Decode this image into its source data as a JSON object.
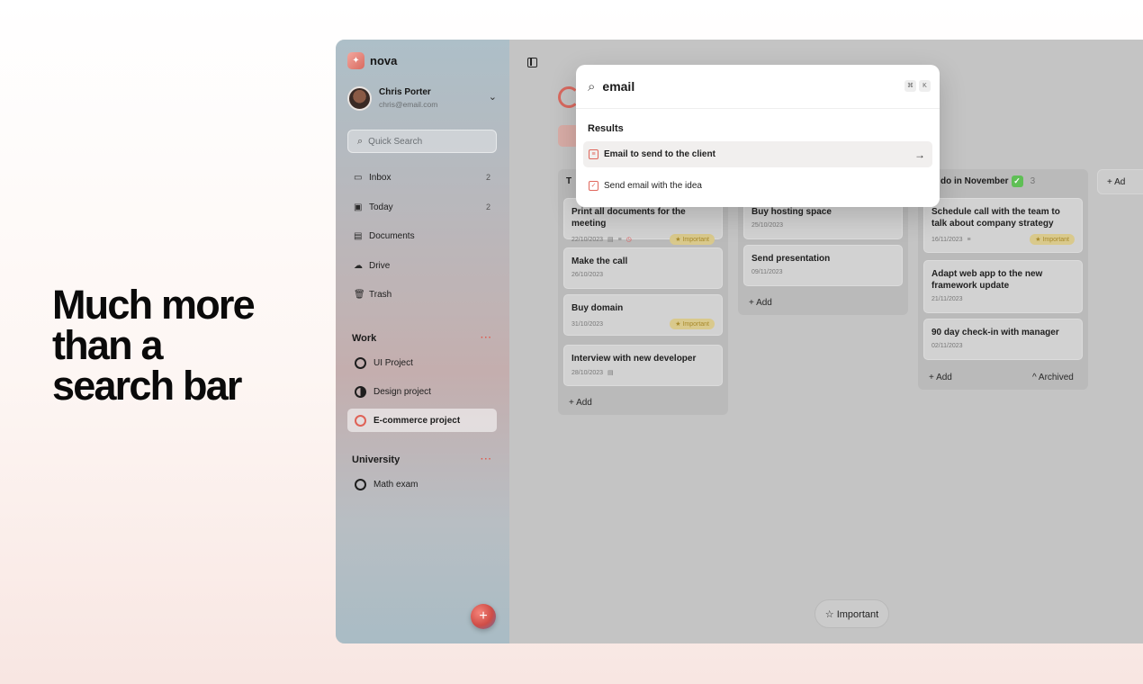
{
  "headline": "Much more\nthan a\nsearch bar",
  "brand": {
    "name": "nova"
  },
  "user": {
    "name": "Chris Porter",
    "email": "chris@email.com"
  },
  "sidebar": {
    "quick_search": "Quick Search",
    "nav": [
      {
        "label": "Inbox",
        "count": "2",
        "icon": "inbox-icon"
      },
      {
        "label": "Today",
        "count": "2",
        "icon": "calendar-icon"
      },
      {
        "label": "Documents",
        "count": "",
        "icon": "document-icon"
      },
      {
        "label": "Drive",
        "count": "",
        "icon": "cloud-icon"
      },
      {
        "label": "Trash",
        "count": "",
        "icon": "trash-icon"
      }
    ],
    "sections": [
      {
        "title": "Work",
        "more": "···",
        "projects": [
          "UI Project",
          "Design project",
          "E-commerce project"
        ]
      },
      {
        "title": "University",
        "more": "···",
        "projects": [
          "Math exam"
        ]
      }
    ]
  },
  "board": {
    "columns": [
      {
        "title": "T",
        "count": "",
        "cards": [
          {
            "title": "Print all documents for the meeting",
            "date": "22/10/2023",
            "tag": "★ Important"
          },
          {
            "title": "Make the call",
            "date": "26/10/2023",
            "tag": ""
          },
          {
            "title": "Buy domain",
            "date": "31/10/2023",
            "tag": "★ Important"
          },
          {
            "title": "Interview with new developer",
            "date": "28/10/2023",
            "tag": ""
          }
        ],
        "add": "+ Add"
      },
      {
        "title": "",
        "count": "",
        "cards": [
          {
            "title": "Buy hosting space",
            "date": "25/10/2023",
            "tag": ""
          },
          {
            "title": "Send presentation",
            "date": "09/11/2023",
            "tag": ""
          }
        ],
        "add": "+ Add"
      },
      {
        "title": "do in November",
        "badge": "✓",
        "count": "3",
        "cards": [
          {
            "title": "Schedule call with the team to talk about company strategy",
            "date": "16/11/2023",
            "tag": "★ Important"
          },
          {
            "title": "Adapt web app to the new framework update",
            "date": "21/11/2023",
            "tag": ""
          },
          {
            "title": "90 day check-in with manager",
            "date": "02/11/2023",
            "tag": ""
          }
        ],
        "add": "+ Add",
        "archived": "^ Archived"
      }
    ],
    "add_column": "+ Ad",
    "important_button": "☆ Important"
  },
  "palette": {
    "query": "email",
    "kbd": [
      "⌘",
      "K"
    ],
    "results_label": "Results",
    "results": [
      {
        "label": "Email to send to the client",
        "icon": "document-icon",
        "arrow": "→"
      },
      {
        "label": "Send email with the idea",
        "icon": "checkbox-icon",
        "arrow": ""
      }
    ]
  }
}
